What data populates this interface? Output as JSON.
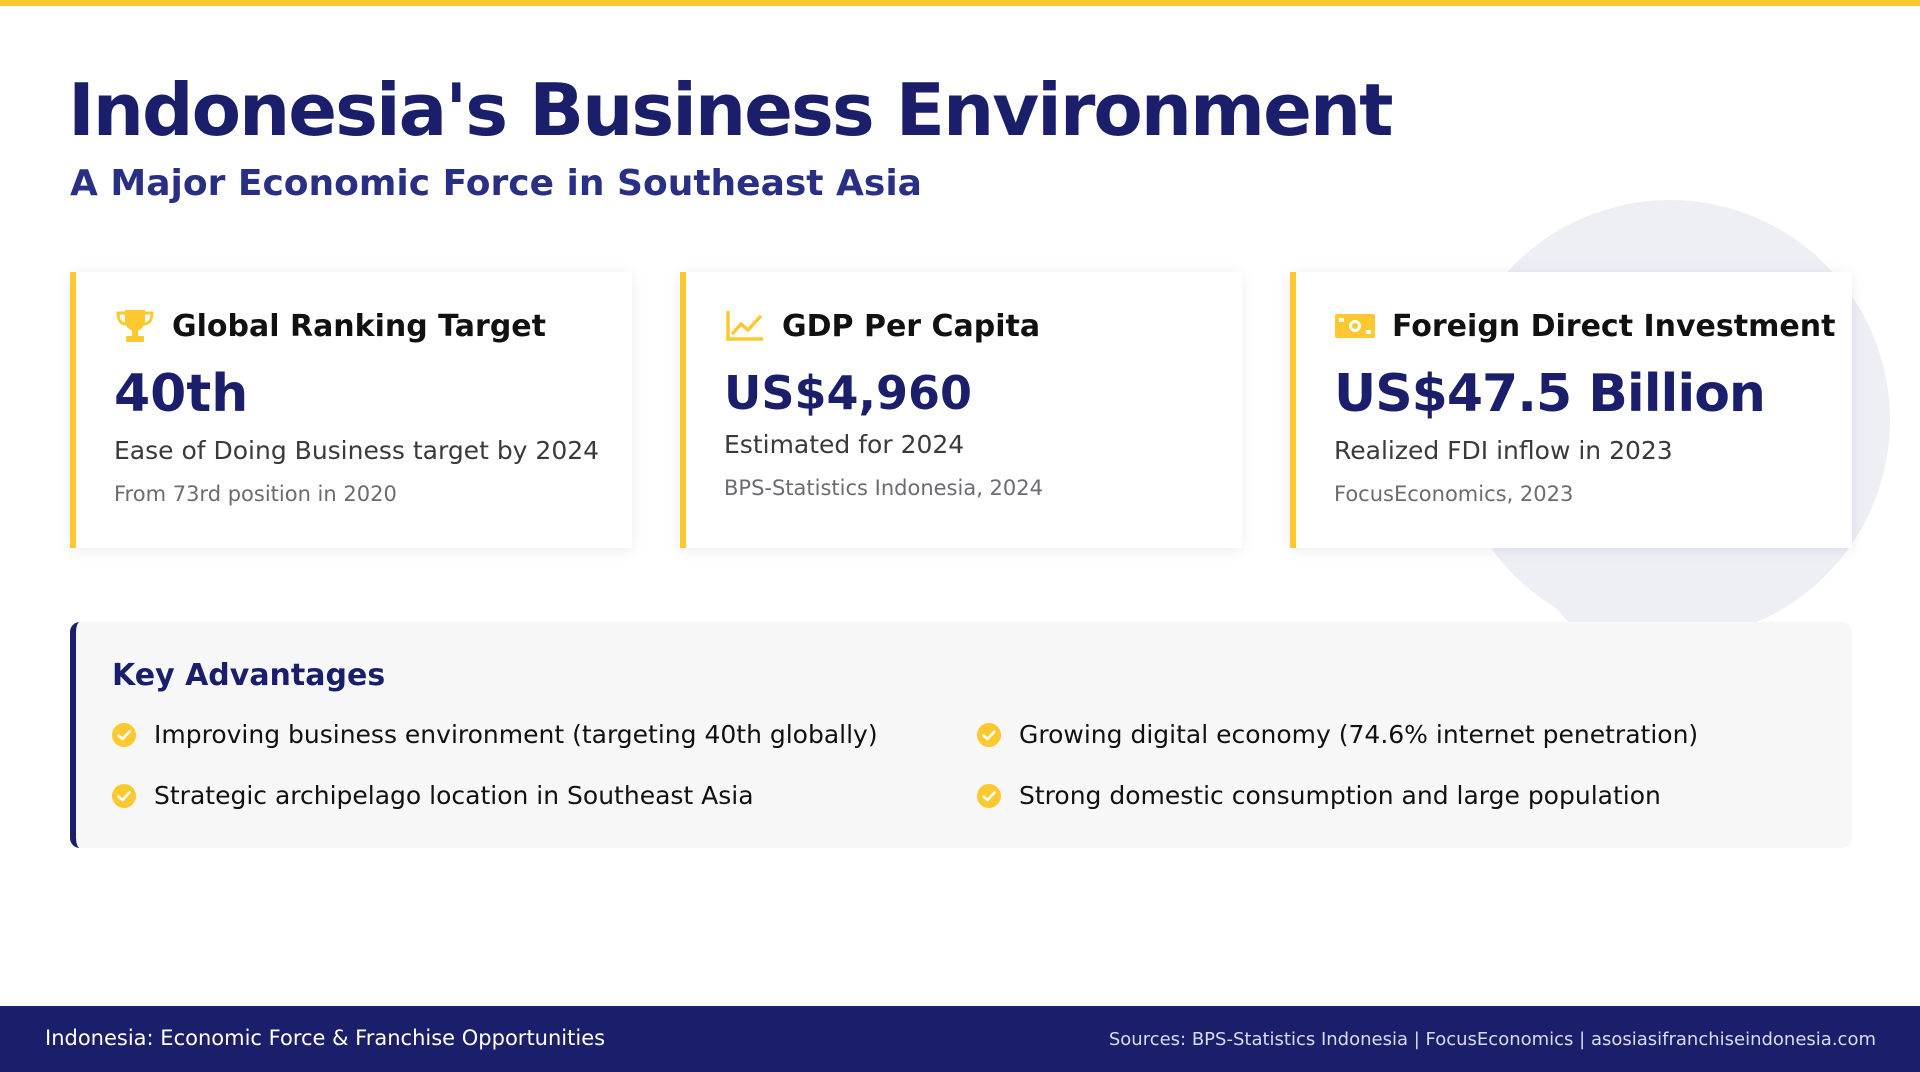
{
  "header": {
    "title": "Indonesia's Business Environment",
    "subtitle": "A Major Economic Force in Southeast Asia"
  },
  "cards": [
    {
      "icon": "trophy-icon",
      "label": "Global Ranking Target",
      "value": "40th",
      "description": "Ease of Doing Business target by 2024",
      "note": "From 73rd position in 2020"
    },
    {
      "icon": "chart-line-icon",
      "label": "GDP Per Capita",
      "value": "US$4,960",
      "description": "Estimated for 2024",
      "note": "BPS-Statistics Indonesia, 2024"
    },
    {
      "icon": "money-bill-icon",
      "label": "Foreign Direct Investment",
      "value": "US$47.5 Billion",
      "description": "Realized FDI inflow in 2023",
      "note": "FocusEconomics, 2023"
    }
  ],
  "advantages": {
    "title": "Key Advantages",
    "items": [
      "Improving business environment (targeting 40th globally)",
      "Growing digital economy (74.6% internet penetration)",
      "Strategic archipelago location in Southeast Asia",
      "Strong domestic consumption and large population"
    ]
  },
  "footer": {
    "left": "Indonesia: Economic Force & Franchise Opportunities",
    "right": "Sources: BPS-Statistics Indonesia | FocusEconomics | asosiasifranchiseindonesia.com"
  },
  "colors": {
    "accent": "#fdc830",
    "navy": "#1b1f6b",
    "panel": "#f7f7f8"
  }
}
